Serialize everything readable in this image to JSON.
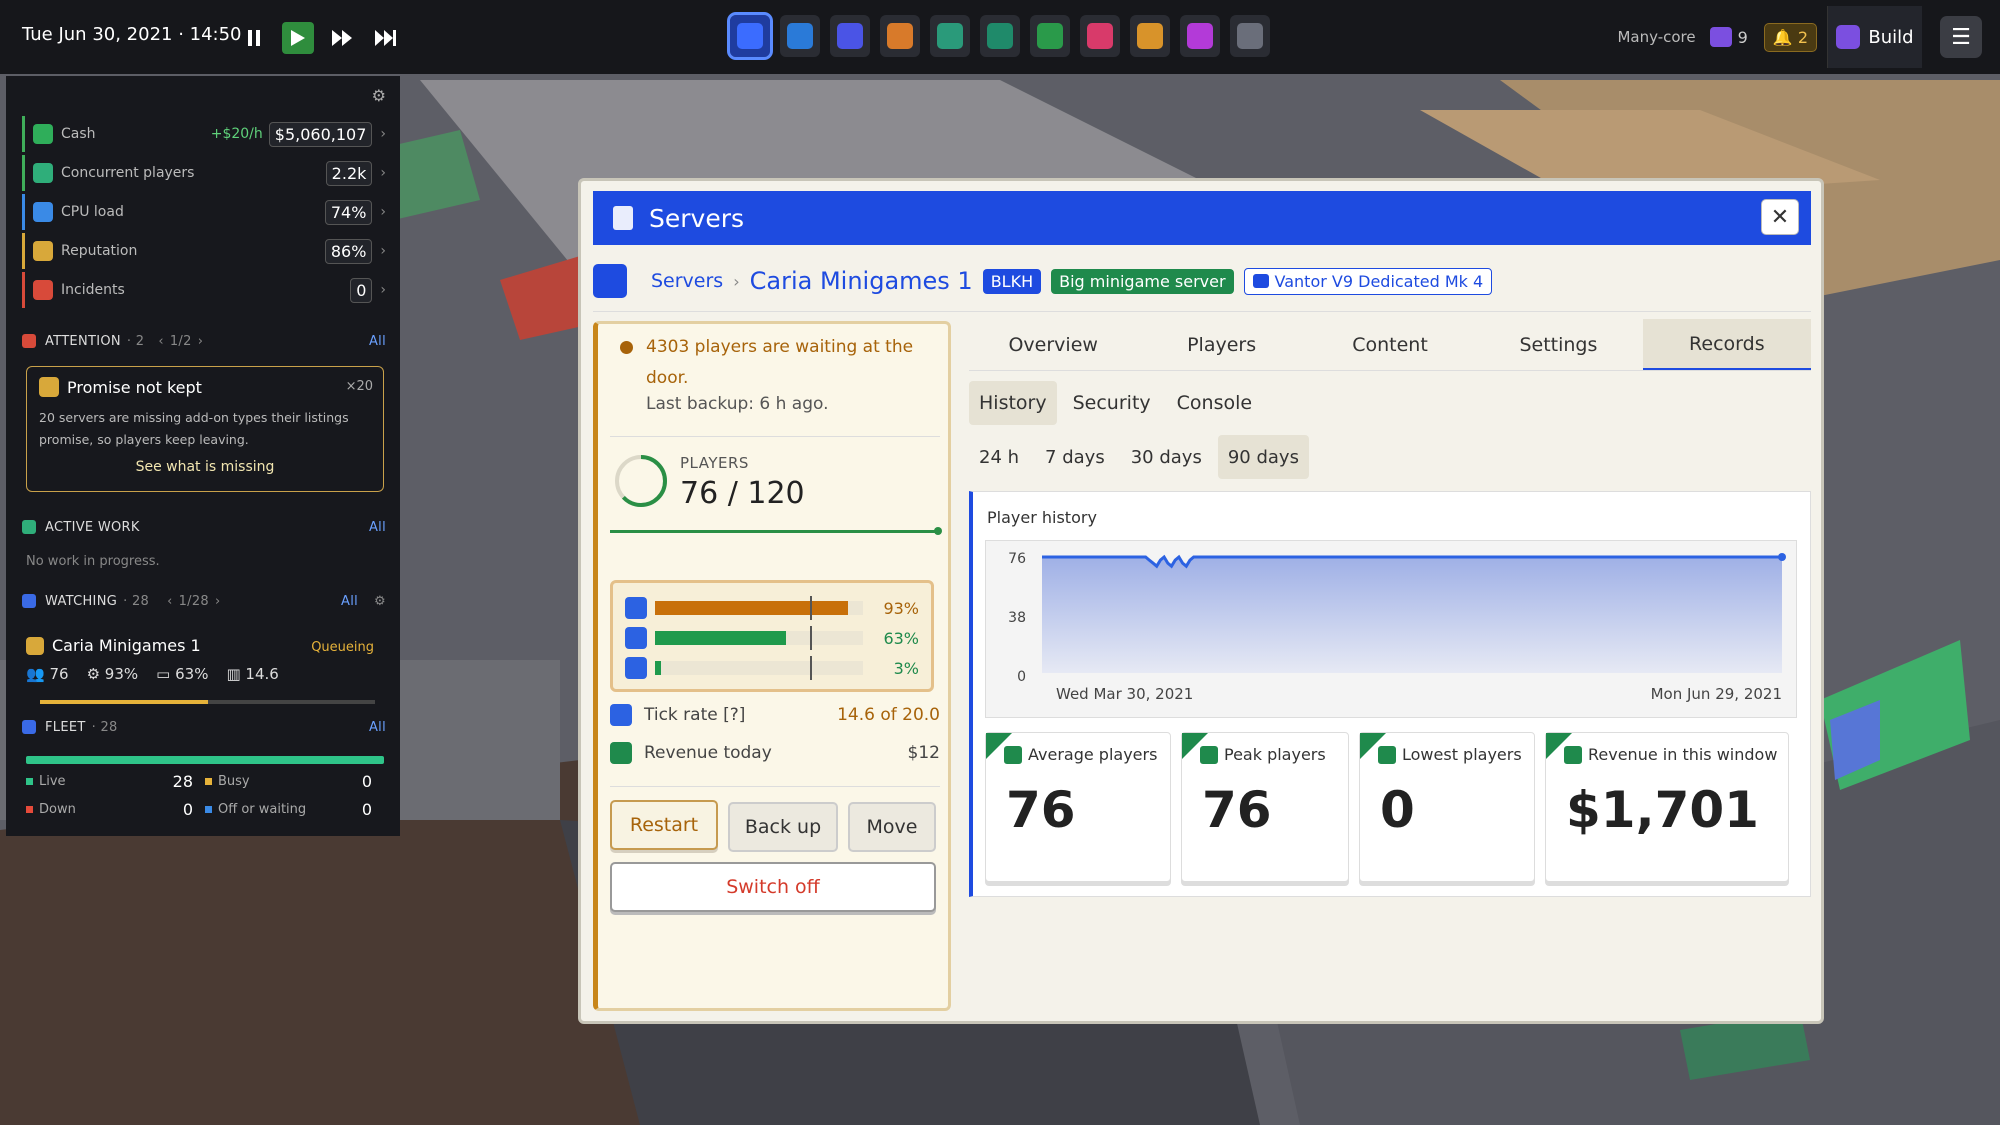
{
  "topbar": {
    "datetime": "Tue Jun 30, 2021 · 14:50",
    "mode": "Many-core",
    "cores_count": "9",
    "alerts_count": "2",
    "build_label": "Build"
  },
  "colors": {
    "accent_blue": "#1e4be0",
    "green": "#1f8a4c",
    "amber": "#c8861a",
    "danger": "#d43a2a"
  },
  "sidebar": {
    "stats": [
      {
        "label": "Cash",
        "rate": "+$20/h",
        "value": "$5,060,107",
        "icon": "cash-icon"
      },
      {
        "label": "Concurrent players",
        "value": "2.2k",
        "icon": "players-icon"
      },
      {
        "label": "CPU load",
        "value": "74%",
        "icon": "cpu-icon"
      },
      {
        "label": "Reputation",
        "value": "86%",
        "icon": "reputation-icon"
      },
      {
        "label": "Incidents",
        "value": "0",
        "icon": "incident-icon"
      }
    ],
    "attention": {
      "label": "ATTENTION",
      "count": "· 2",
      "pager": "1/2",
      "all": "All"
    },
    "alert": {
      "title": "Promise not kept",
      "count": "×20",
      "desc": "20 servers are missing add-on types their listings promise, so players keep leaving.",
      "link": "See what is missing"
    },
    "active_work": {
      "label": "ACTIVE WORK",
      "all": "All",
      "empty": "No work in progress."
    },
    "watching": {
      "label": "WATCHING",
      "count": "· 28",
      "pager": "1/28",
      "all": "All",
      "server": {
        "name": "Caria Minigames 1",
        "status": "Queueing",
        "players": "76",
        "cpu": "93%",
        "mem": "63%",
        "tick": "14.6",
        "progress": 0.5
      }
    },
    "fleet": {
      "label": "FLEET",
      "count": "· 28",
      "all": "All",
      "live_label": "Live",
      "live": "28",
      "busy_label": "Busy",
      "busy": "0",
      "down_label": "Down",
      "down": "0",
      "off_label": "Off or waiting",
      "off": "0"
    }
  },
  "window": {
    "title": "Servers",
    "breadcrumb": {
      "parent": "Servers",
      "name": "Caria Minigames 1",
      "tag1": "BLKH",
      "tag2": "Big minigame server",
      "hardware": "Vantor V9 Dedicated Mk 4"
    },
    "status": {
      "warning": "4303 players are waiting at the door.",
      "backup": "Last backup: 6 h ago."
    },
    "players": {
      "label": "PLAYERS",
      "value": "76 / 120",
      "fraction": 0.63
    },
    "resources": [
      {
        "name": "cpu",
        "pct": "93%",
        "fraction": 0.93,
        "color": "#c8700a"
      },
      {
        "name": "memory",
        "pct": "63%",
        "fraction": 0.63,
        "color": "#1f9a4c"
      },
      {
        "name": "network",
        "pct": "3%",
        "fraction": 0.03,
        "color": "#1f9a4c"
      }
    ],
    "tick": {
      "label": "Tick rate [?]",
      "value": "14.6 of 20.0"
    },
    "revenue": {
      "label": "Revenue today",
      "value": "$12"
    },
    "buttons": {
      "restart": "Restart",
      "backup": "Back up",
      "move": "Move",
      "switch_off": "Switch off"
    },
    "tabs": [
      "Overview",
      "Players",
      "Content",
      "Settings",
      "Records"
    ],
    "active_tab": "Records",
    "subtabs": [
      "History",
      "Security",
      "Console"
    ],
    "ranges": [
      "24 h",
      "7 days",
      "30 days",
      "90 days"
    ],
    "cards": [
      {
        "label": "Average players",
        "value": "76"
      },
      {
        "label": "Peak players",
        "value": "76"
      },
      {
        "label": "Lowest players",
        "value": "0"
      },
      {
        "label": "Revenue in this window",
        "value": "$1,701"
      }
    ]
  },
  "chart_data": {
    "type": "area",
    "title": "Player history",
    "x_start": "Wed Mar 30, 2021",
    "x_end": "Mon Jun 29, 2021",
    "yticks": [
      "76",
      "38",
      "0"
    ],
    "ylim": [
      0,
      76
    ],
    "x": [
      0,
      0.14,
      0.145,
      0.15,
      0.155,
      0.16,
      0.165,
      0.17,
      0.175,
      0.18,
      0.185,
      0.19,
      0.195,
      0.2,
      0.205,
      1
    ],
    "values": [
      76,
      76,
      74,
      72,
      70,
      74,
      76,
      72,
      70,
      74,
      76,
      72,
      70,
      74,
      76,
      76
    ],
    "grid": false
  }
}
